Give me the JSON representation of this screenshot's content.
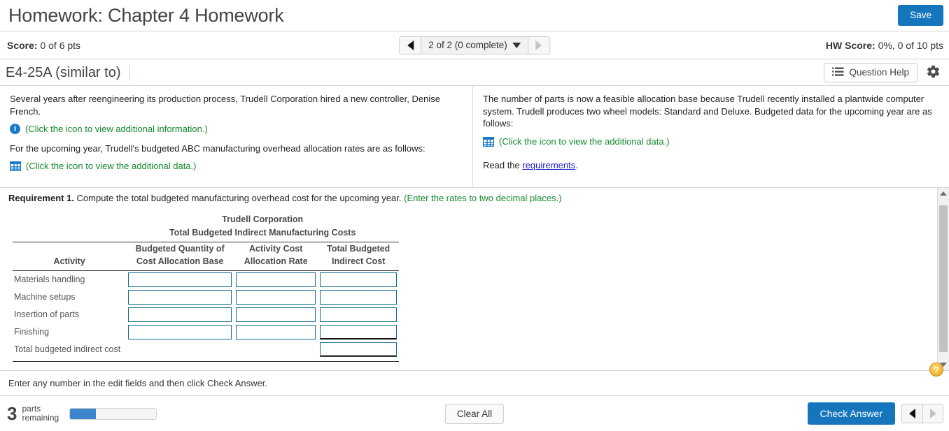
{
  "titlebar": {
    "title": "Homework: Chapter 4 Homework",
    "save_label": "Save"
  },
  "scorebar": {
    "score_label": "Score:",
    "score_value": " 0 of 6 pts",
    "nav_label": "2 of 2 (0 complete)",
    "hw_score_label": "HW Score:",
    "hw_score_value": " 0%, 0 of 10 pts",
    "prev_icon": "triangle-left-icon",
    "next_icon": "triangle-right-icon",
    "caret_icon": "caret-down-icon"
  },
  "question_header": {
    "question_id": "E4-25A (similar to)",
    "help_label": "Question Help",
    "help_icon": "list-icon",
    "settings_icon": "gear-icon"
  },
  "problem": {
    "left": {
      "paragraph1": "Several years after reengineering its production process, Trudell Corporation hired a new controller, Denise French.",
      "info_link": "(Click the icon to view additional information.)",
      "info_icon": "info-circle-icon",
      "paragraph2": "For the upcoming year, Trudell's budgeted ABC manufacturing overhead allocation rates are as follows:",
      "data_link": "(Click the icon to view the additional data.)",
      "data_icon": "grid-table-icon"
    },
    "right": {
      "paragraph1": "The number of parts is now a feasible allocation base because Trudell recently installed a plantwide computer system. Trudell produces two wheel models: Standard and Deluxe. Budgeted data for the upcoming year are as follows:",
      "data_link": "(Click the icon to view the additional data.)",
      "data_icon": "grid-table-icon",
      "read_prefix": "Read the ",
      "read_link": "requirements",
      "read_suffix": "."
    }
  },
  "requirement": {
    "label": "Requirement 1.",
    "text": " Compute the total budgeted manufacturing overhead cost for the upcoming year. ",
    "hint": "(Enter the rates to two decimal places.)"
  },
  "table": {
    "company": "Trudell Corporation",
    "subtitle": "Total Budgeted Indirect Manufacturing Costs",
    "headers": {
      "activity": "Activity",
      "col1_line1": "Budgeted Quantity of",
      "col1_line2": "Cost Allocation Base",
      "col2_line1": "Activity Cost",
      "col2_line2": "Allocation Rate",
      "col3_line1": "Total Budgeted",
      "col3_line2": "Indirect Cost"
    },
    "rows": [
      {
        "label": "Materials handling",
        "qty": "",
        "rate": "",
        "total": ""
      },
      {
        "label": "Machine setups",
        "qty": "",
        "rate": "",
        "total": ""
      },
      {
        "label": "Insertion of parts",
        "qty": "",
        "rate": "",
        "total": ""
      },
      {
        "label": "Finishing",
        "qty": "",
        "rate": "",
        "total": ""
      }
    ],
    "total_row": {
      "label": "Total budgeted indirect cost",
      "total": ""
    }
  },
  "hint_bar": {
    "text": "Enter any number in the edit fields and then click Check Answer.",
    "help_icon": "question-mark-icon",
    "help_glyph": "?"
  },
  "footer": {
    "parts_number": "3",
    "parts_line1": "parts",
    "parts_line2": "remaining",
    "progress_percent": 30,
    "clear_label": "Clear All",
    "check_label": "Check Answer",
    "prev_icon": "triangle-left-icon",
    "next_icon": "triangle-right-icon"
  },
  "scrollbar": {
    "up_icon": "scroll-up-arrow-icon",
    "down_icon": "scroll-down-arrow-icon"
  },
  "colors": {
    "accent_blue": "#1676bd",
    "input_border": "#126d91",
    "green_text": "#138a2c",
    "link_blue": "#1a1ad0"
  }
}
